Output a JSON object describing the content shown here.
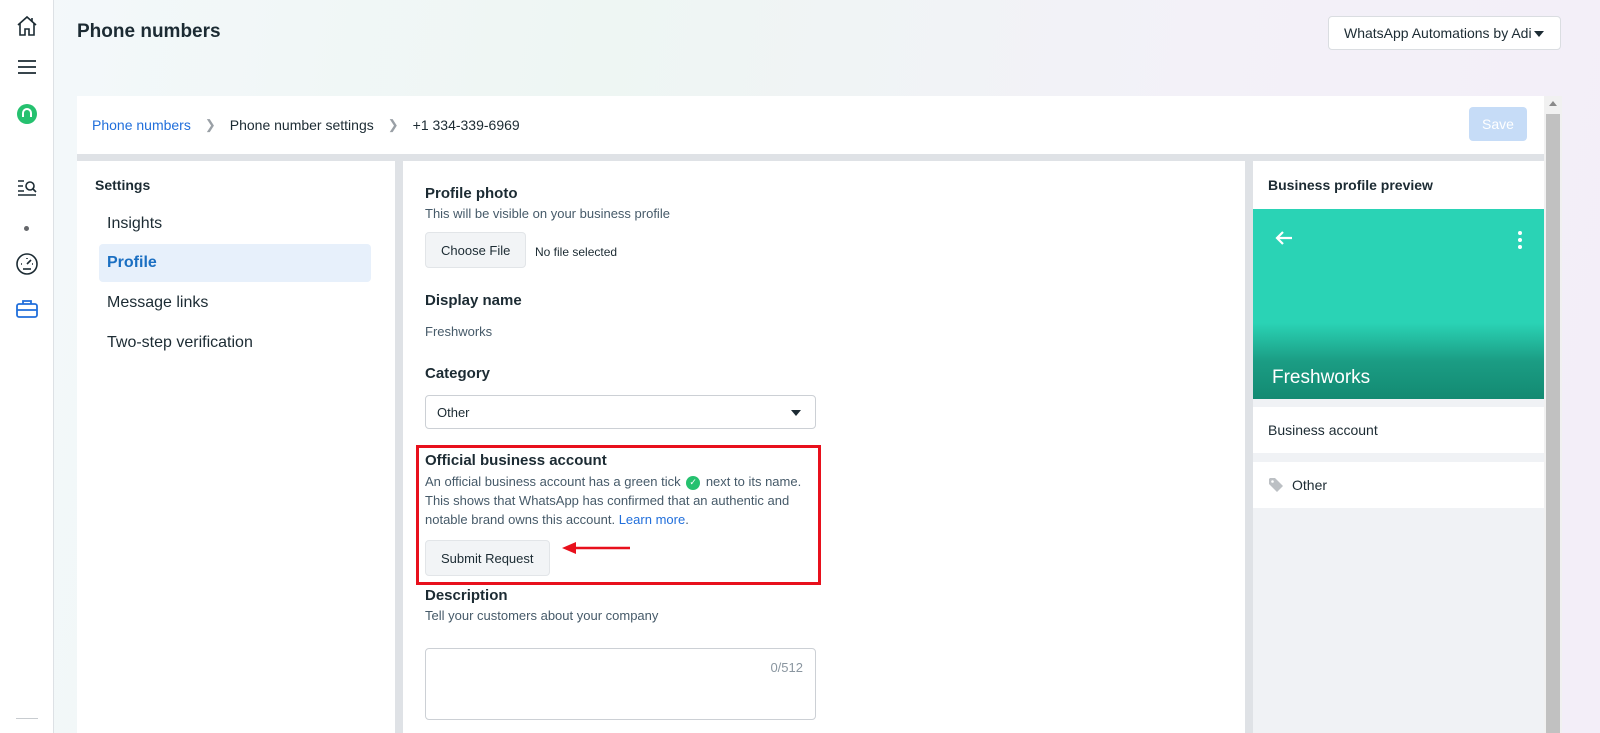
{
  "header": {
    "title": "Phone numbers",
    "account_selector": "WhatsApp Automations by Adi"
  },
  "breadcrumb": {
    "items": [
      "Phone numbers",
      "Phone number settings",
      "+1 334-339-6969"
    ],
    "save_label": "Save"
  },
  "settings": {
    "title": "Settings",
    "items": [
      {
        "label": "Insights",
        "active": false
      },
      {
        "label": "Profile",
        "active": true
      },
      {
        "label": "Message links",
        "active": false
      },
      {
        "label": "Two-step verification",
        "active": false
      }
    ]
  },
  "form": {
    "profile_photo": {
      "label": "Profile photo",
      "help": "This will be visible on your business profile",
      "button": "Choose File",
      "status": "No file selected"
    },
    "display_name": {
      "label": "Display name",
      "value": "Freshworks"
    },
    "category": {
      "label": "Category",
      "value": "Other"
    },
    "official_account": {
      "label": "Official business account",
      "text_before_tick": "An official business account has a green tick",
      "text_after_tick": "next to its name. This shows that WhatsApp has confirmed that an authentic and notable brand owns this account.",
      "learn_more": "Learn more",
      "period": ".",
      "button": "Submit Request"
    },
    "description": {
      "label": "Description",
      "help": "Tell your customers about your company",
      "counter": "0/512"
    }
  },
  "preview": {
    "title": "Business profile preview",
    "business_name": "Freshworks",
    "account_type": "Business account",
    "category": "Other"
  },
  "colors": {
    "accent": "#216fdb",
    "active_nav_bg": "#e7f0fb",
    "highlight": "#e8101c",
    "preview_hero": "#2ad3b5",
    "tick": "#25c16f"
  }
}
